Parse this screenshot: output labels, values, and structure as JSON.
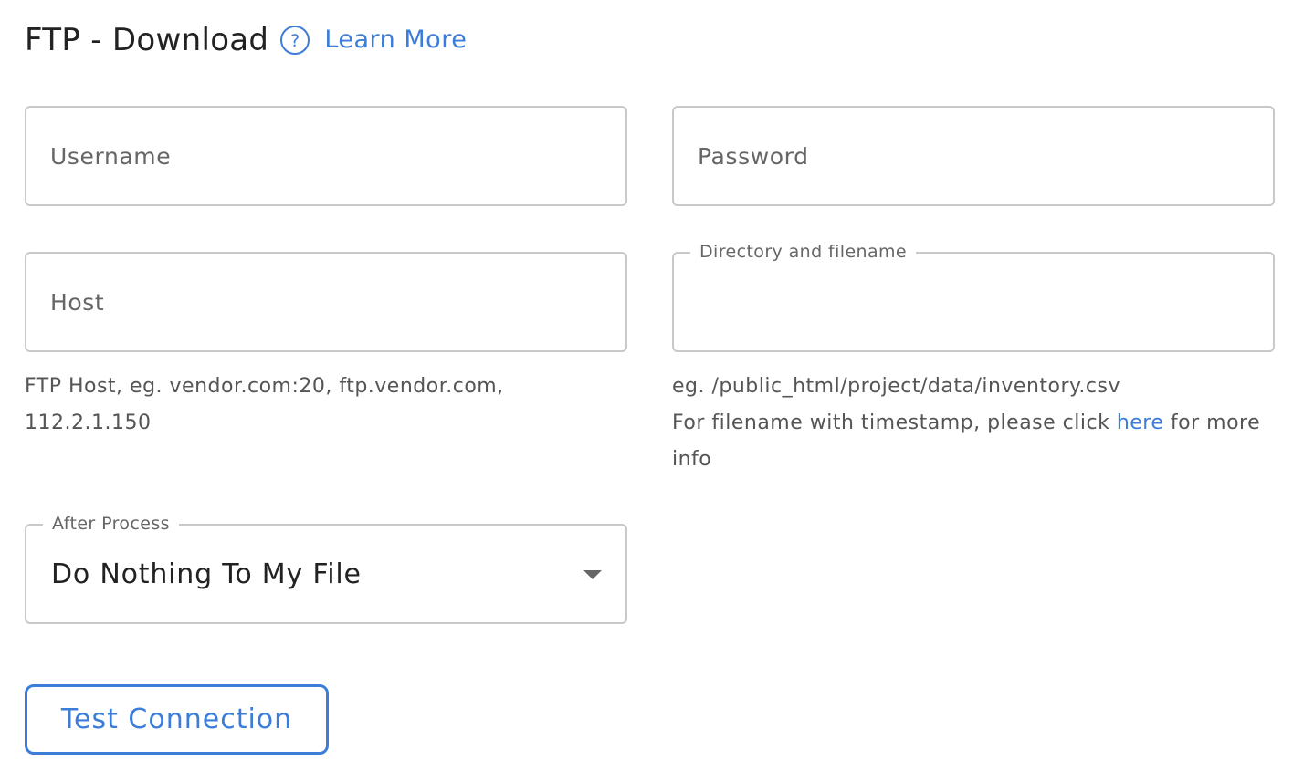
{
  "header": {
    "title": "FTP - Download",
    "help_icon": "question-circle-icon",
    "learn_more": "Learn More"
  },
  "fields": {
    "username": {
      "placeholder": "Username",
      "value": ""
    },
    "password": {
      "placeholder": "Password",
      "value": ""
    },
    "host": {
      "placeholder": "Host",
      "value": "",
      "helper": "FTP Host, eg. vendor.com:20, ftp.vendor.com, 112.2.1.150"
    },
    "directory": {
      "label": "Directory and filename",
      "value": "",
      "helper_example": "eg. /public_html/project/data/inventory.csv",
      "helper_prefix": "For filename with timestamp, please click",
      "helper_link": "here",
      "helper_suffix": "for more info"
    },
    "after_process": {
      "label": "After Process",
      "selected": "Do Nothing To My File",
      "icon": "caret-down-icon"
    }
  },
  "actions": {
    "test_connection": "Test Connection"
  },
  "colors": {
    "accent": "#3b7dd8",
    "border": "#c9c9c9",
    "text": "#222222",
    "muted": "#666666"
  }
}
